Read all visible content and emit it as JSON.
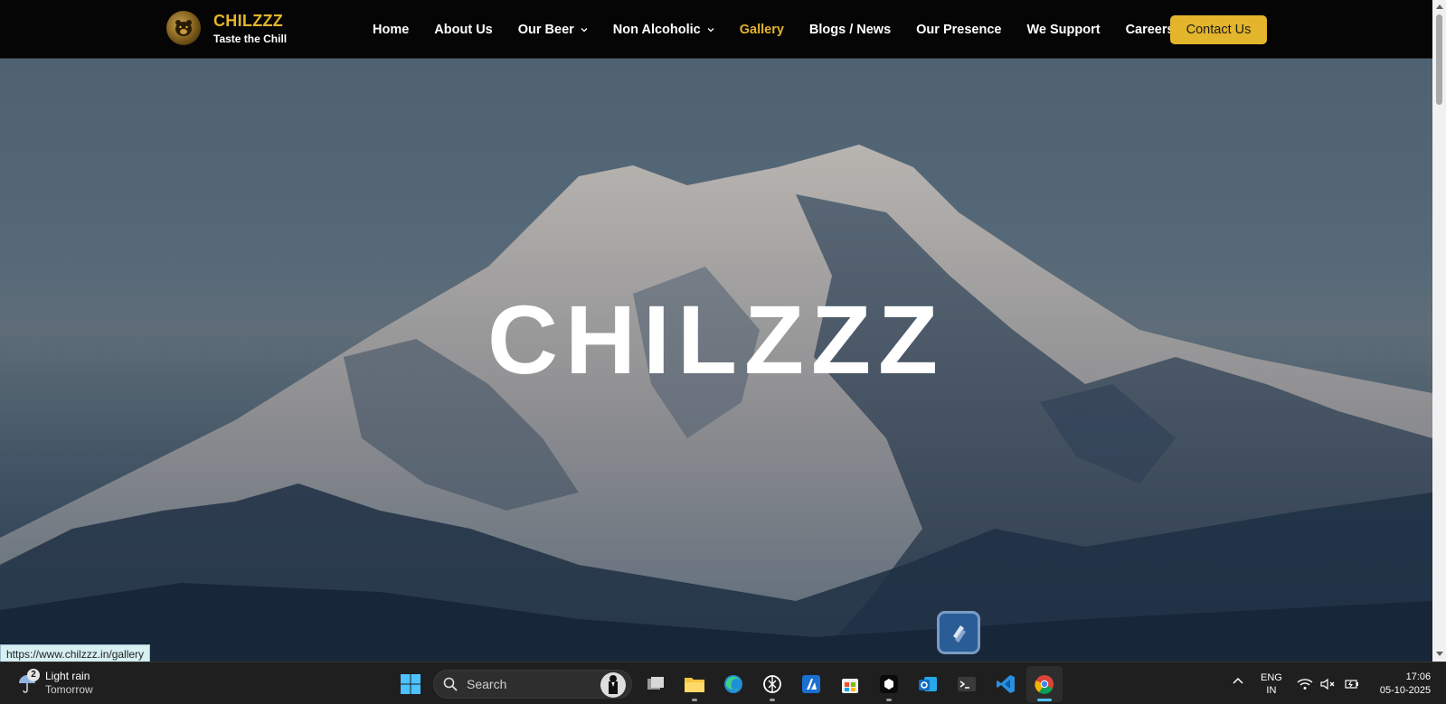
{
  "brand": {
    "name": "CHILZZZ",
    "tagline": "Taste the Chill",
    "logo_icon": "bear-logo-icon"
  },
  "nav": {
    "items": [
      {
        "label": "Home",
        "dropdown": false,
        "active": false
      },
      {
        "label": "About Us",
        "dropdown": false,
        "active": false
      },
      {
        "label": "Our Beer",
        "dropdown": true,
        "active": false
      },
      {
        "label": "Non Alcoholic",
        "dropdown": true,
        "active": false
      },
      {
        "label": "Gallery",
        "dropdown": false,
        "active": true
      },
      {
        "label": "Blogs / News",
        "dropdown": false,
        "active": false
      },
      {
        "label": "Our Presence",
        "dropdown": false,
        "active": false
      },
      {
        "label": "We Support",
        "dropdown": false,
        "active": false
      },
      {
        "label": "Careers",
        "dropdown": false,
        "active": false
      }
    ],
    "contact_label": "Contact Us"
  },
  "hero": {
    "title": "CHILZZZ",
    "background": "snow-mountain-image"
  },
  "status_bar": {
    "url": "https://www.chilzzz.in/gallery"
  },
  "taskbar": {
    "weather": {
      "badge": "2",
      "condition": "Light rain",
      "when": "Tomorrow",
      "icon": "umbrella-rain-icon"
    },
    "search_placeholder": "Search",
    "pinned": [
      "start-icon",
      "task-view-icon",
      "file-explorer-icon",
      "edge-icon",
      "chatgpt-icon",
      "azure-icon",
      "store-icon",
      "box-app-icon",
      "outlook-icon",
      "terminal-icon",
      "vscode-icon",
      "chrome-icon"
    ],
    "language": {
      "line1": "ENG",
      "line2": "IN"
    },
    "clock": {
      "time": "17:06",
      "date": "05-10-2025"
    }
  },
  "colors": {
    "accent": "#e3b52c",
    "navbar_bg": "#050505",
    "taskbar_bg": "#1f1f1f"
  }
}
